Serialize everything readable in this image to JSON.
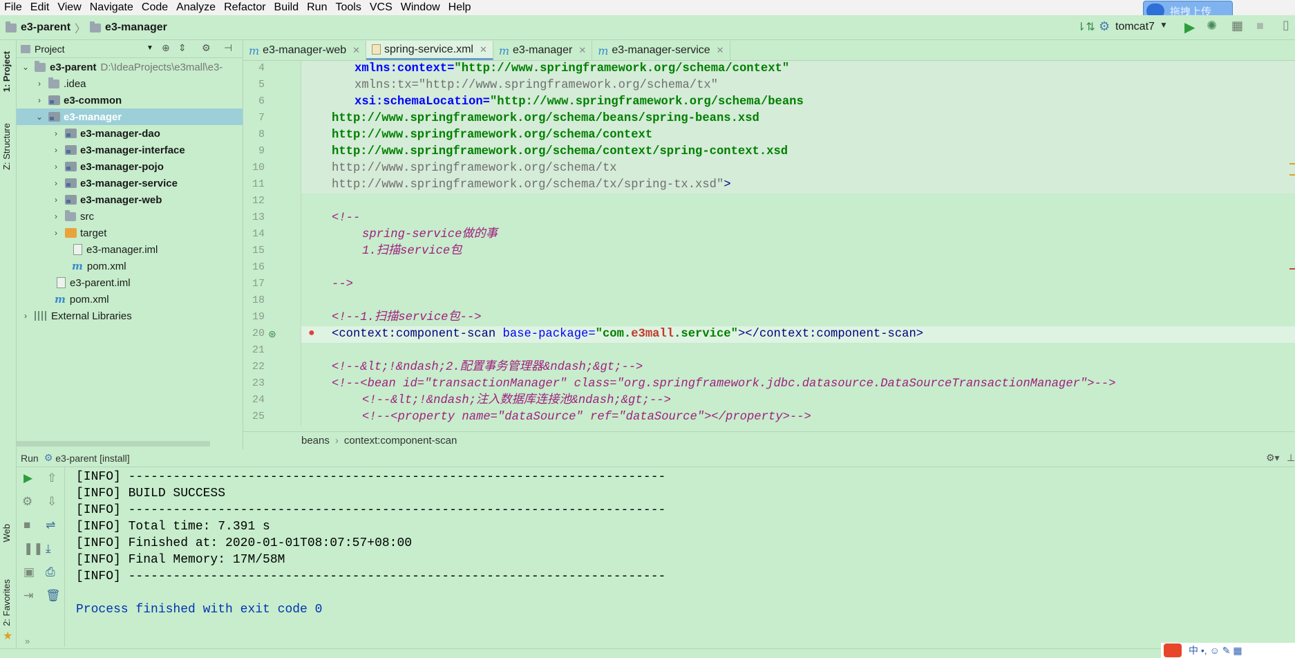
{
  "menu": [
    "File",
    "Edit",
    "View",
    "Navigate",
    "Code",
    "Analyze",
    "Refactor",
    "Build",
    "Run",
    "Tools",
    "VCS",
    "Window",
    "Help"
  ],
  "breadcrumb": {
    "root": "e3-parent",
    "child": "e3-manager"
  },
  "run_config": "tomcat7",
  "upload_button": "拖拽上传",
  "left_tabs": {
    "project": "1: Project",
    "structure": "Z: Structure",
    "web": "Web",
    "favorites": "2: Favorites"
  },
  "project_panel": {
    "title": "Project",
    "tree": [
      {
        "label": "e3-parent",
        "suffix": "D:\\IdeaProjects\\e3mall\\e3-"
      },
      {
        "label": ".idea"
      },
      {
        "label": "e3-common"
      },
      {
        "label": "e3-manager"
      },
      {
        "label": "e3-manager-dao"
      },
      {
        "label": "e3-manager-interface"
      },
      {
        "label": "e3-manager-pojo"
      },
      {
        "label": "e3-manager-service"
      },
      {
        "label": "e3-manager-web"
      },
      {
        "label": "src"
      },
      {
        "label": "target"
      },
      {
        "label": "e3-manager.iml"
      },
      {
        "label": "pom.xml"
      },
      {
        "label": "e3-parent.iml"
      },
      {
        "label": "pom.xml"
      },
      {
        "label": "External Libraries"
      }
    ]
  },
  "tabs": [
    {
      "label": "e3-manager-web"
    },
    {
      "label": "spring-service.xml"
    },
    {
      "label": "e3-manager"
    },
    {
      "label": "e3-manager-service"
    }
  ],
  "line_numbers": [
    "4",
    "5",
    "6",
    "7",
    "8",
    "9",
    "10",
    "11",
    "12",
    "13",
    "14",
    "15",
    "16",
    "17",
    "18",
    "19",
    "20",
    "21",
    "22",
    "23",
    "24",
    "25"
  ],
  "code": {
    "l4a": "xmlns:context=",
    "l4b": "\"http://www.springframework.org/schema/context\"",
    "l5": "xmlns:tx=\"http://www.springframework.org/schema/tx\"",
    "l6a": "xsi:schemaLocation=",
    "l6b": "\"http://www.springframework.org/schema/beans",
    "l7": "http://www.springframework.org/schema/beans/spring-beans.xsd",
    "l8": "http://www.springframework.org/schema/context",
    "l9": "http://www.springframework.org/schema/context/spring-context.xsd",
    "l10": "http://www.springframework.org/schema/tx",
    "l11a": "http://www.springframework.org/schema/tx/spring-tx.xsd\"",
    "l11b": ">",
    "l13": "<!--",
    "l14": "spring-service做的事",
    "l15": "1.扫描service包",
    "l17": "-->",
    "l19": "<!--1.扫描service包-->",
    "l20a": "<context:component-scan ",
    "l20b": "base-package=",
    "l20c": "\"com.",
    "l20d": "e3mall",
    "l20e": ".service\"",
    "l20f": "></context:component-scan>",
    "l22": "<!--&lt;!&ndash;2.配置事务管理器&ndash;&gt;-->",
    "l23": "<!--<bean id=\"transactionManager\" class=\"org.springframework.jdbc.datasource.DataSourceTransactionManager\">-->",
    "l24": "<!--&lt;!&ndash;注入数据库连接池&ndash;&gt;-->",
    "l25": "<!--<property name=\"dataSource\" ref=\"dataSource\"></property>-->"
  },
  "editor_breadcrumb": {
    "a": "beans",
    "b": "context:component-scan"
  },
  "run_panel": {
    "title": "Run",
    "config": "e3-parent [install]",
    "console": [
      "[INFO] ------------------------------------------------------------------------",
      "[INFO] BUILD SUCCESS",
      "[INFO] ------------------------------------------------------------------------",
      "[INFO] Total time: 7.391 s",
      "[INFO] Finished at: 2020-01-01T08:07:57+08:00",
      "[INFO] Final Memory: 17M/58M",
      "[INFO] ------------------------------------------------------------------------",
      "",
      "Process finished with exit code 0"
    ]
  }
}
